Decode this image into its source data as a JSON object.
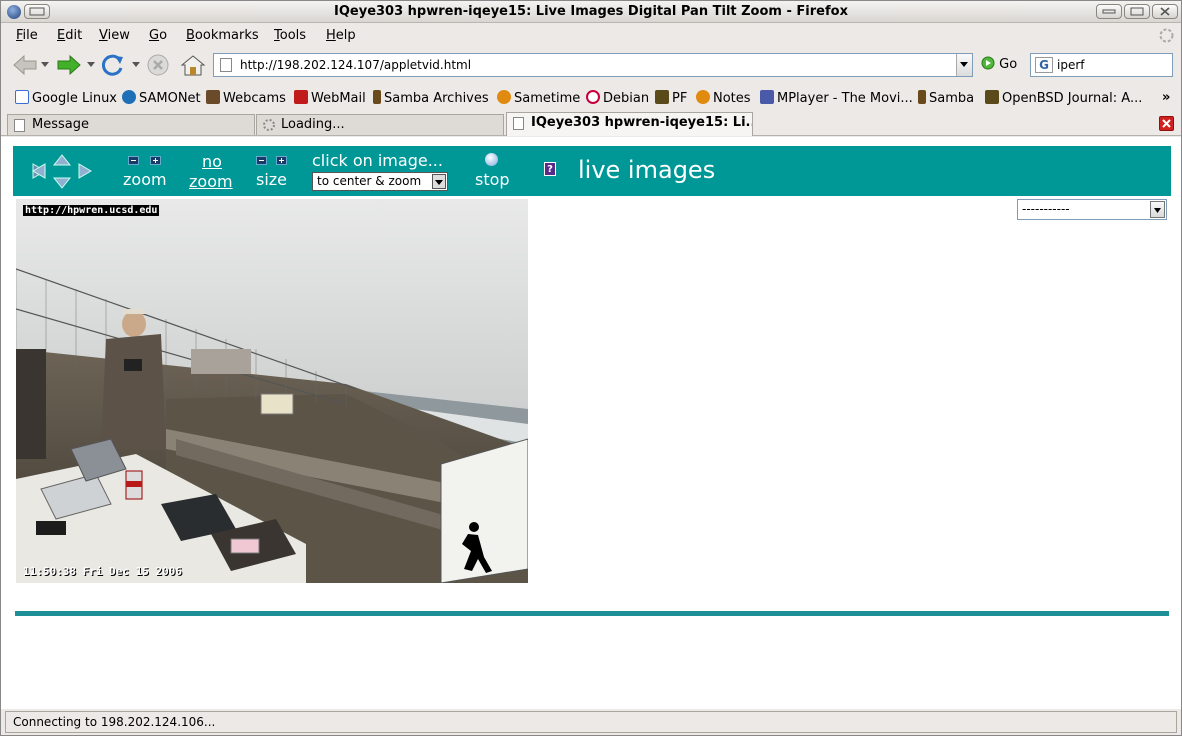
{
  "window": {
    "title": "IQeye303 hpwren-iqeye15: Live Images Digital Pan Tilt Zoom - Firefox"
  },
  "menubar": {
    "items": [
      {
        "label": "File"
      },
      {
        "label": "Edit"
      },
      {
        "label": "View"
      },
      {
        "label": "Go"
      },
      {
        "label": "Bookmarks"
      },
      {
        "label": "Tools"
      },
      {
        "label": "Help"
      }
    ]
  },
  "navbar": {
    "url": "http://198.202.124.107/appletvid.html",
    "go_label": "Go",
    "search_value": "iperf",
    "search_engine_icon": "google-icon"
  },
  "bookmarks": [
    {
      "label": "Google Linux",
      "icon": "google-icon",
      "color": "#3b6fd4"
    },
    {
      "label": "SAMONet",
      "icon": "drupal-icon",
      "color": "#1f6fb8"
    },
    {
      "label": "Webcams",
      "icon": "badge-icon",
      "color": "#6b4a2a"
    },
    {
      "label": "WebMail",
      "icon": "y-mail-icon",
      "color": "#c01a1a"
    },
    {
      "label": "Samba Archives",
      "icon": "samba-icon",
      "color": "#6a4a1a"
    },
    {
      "label": "Sametime",
      "icon": "sametime-icon",
      "color": "#e08a10"
    },
    {
      "label": "Debian",
      "icon": "debian-icon",
      "color": "#c8003c"
    },
    {
      "label": "PF",
      "icon": "puffy-icon",
      "color": "#5a4a1a"
    },
    {
      "label": "Notes",
      "icon": "notes-icon",
      "color": "#e08a10"
    },
    {
      "label": "MPlayer - The Movi...",
      "icon": "mplayer-icon",
      "color": "#4a5aa8"
    },
    {
      "label": "Samba",
      "icon": "samba-icon",
      "color": "#6a4a1a"
    },
    {
      "label": "OpenBSD Journal: A...",
      "icon": "puffy-icon",
      "color": "#5a4a1a"
    }
  ],
  "bookmarks_overflow": "»",
  "tabs": [
    {
      "label": "Message",
      "active": false
    },
    {
      "label": "Loading...",
      "active": false
    },
    {
      "label": "IQeye303 hpwren-iqeye15: Li...",
      "active": true
    }
  ],
  "controls": {
    "zoom_label": "zoom",
    "no_zoom_line1": "no",
    "no_zoom_line2": "zoom",
    "size_label": "size",
    "click_label": "click on image...",
    "zoom_mode_selected": "to center & zoom",
    "stop_label": "stop",
    "help_glyph": "?",
    "heading": "live images"
  },
  "camera": {
    "overlay_url": "http://hpwren.ucsd.edu",
    "timestamp": "11:50:38 Fri Dec 15 2006"
  },
  "right_select": {
    "selected": "-----------"
  },
  "status": {
    "text": "Connecting to 198.202.124.106..."
  },
  "colors": {
    "accent": "#009797",
    "rule": "#1d8f96"
  }
}
